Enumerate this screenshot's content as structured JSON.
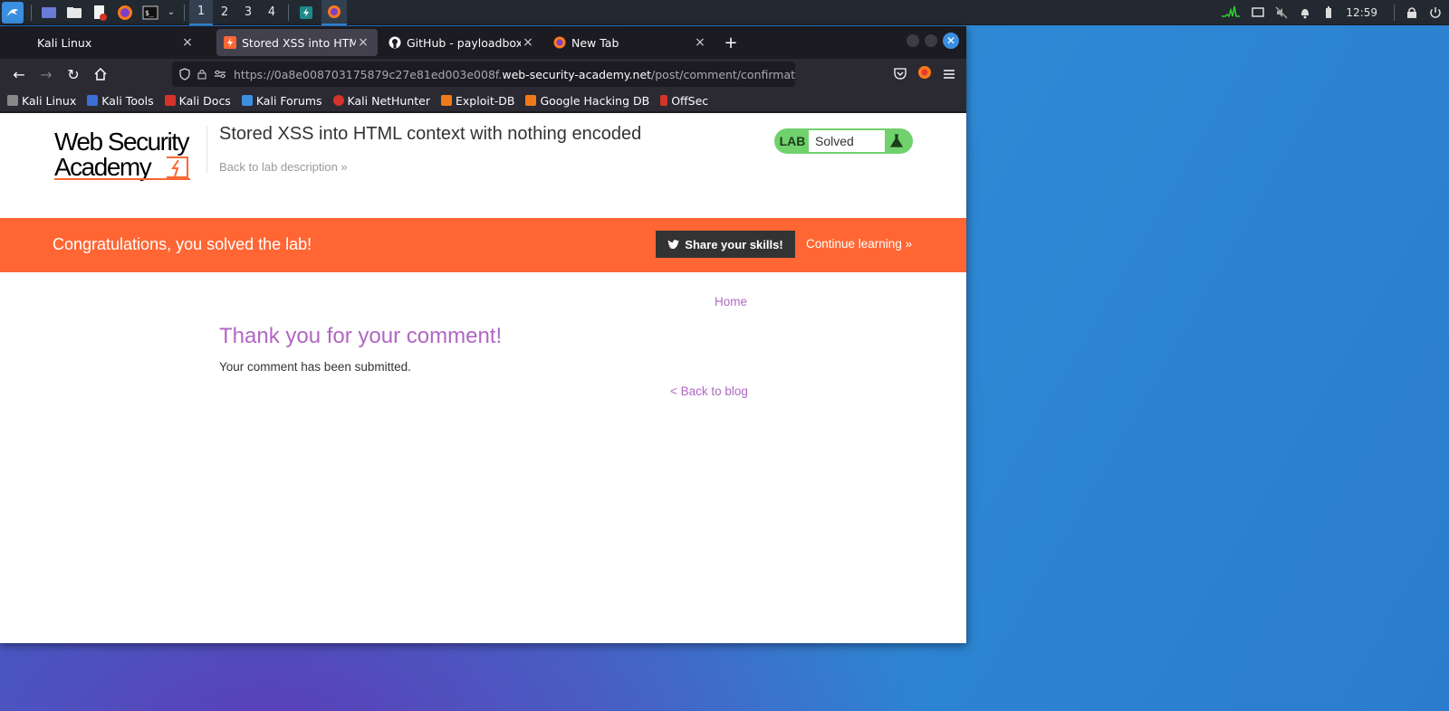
{
  "taskbar": {
    "workspaces": [
      "1",
      "2",
      "3",
      "4"
    ],
    "clock": "12:59"
  },
  "browser": {
    "tabs": [
      {
        "label": "Kali Linux"
      },
      {
        "label": "Stored XSS into HTML con"
      },
      {
        "label": "GitHub - payloadbox/xss-"
      },
      {
        "label": "New Tab"
      }
    ],
    "url": {
      "pre": "https://0a8e008703175879c27e81ed003e008f.",
      "host": "web-security-academy.net",
      "post": "/post/comment/confirmation"
    },
    "bookmarks": [
      "Kali Linux",
      "Kali Tools",
      "Kali Docs",
      "Kali Forums",
      "Kali NetHunter",
      "Exploit-DB",
      "Google Hacking DB",
      "OffSec"
    ]
  },
  "page": {
    "logo_line1": "Web Security",
    "logo_line2": "Academy",
    "lab_title": "Stored XSS into HTML context with nothing encoded",
    "back_to_description": "Back to lab description",
    "badge_label": "LAB",
    "badge_status": "Solved",
    "banner_message": "Congratulations, you solved the lab!",
    "share_label": "Share your skills!",
    "continue_label": "Continue learning",
    "home_link": "Home",
    "heading": "Thank you for your comment!",
    "submitted_text": "Your comment has been submitted.",
    "back_to_blog": "< Back to blog"
  },
  "colors": {
    "brand_orange": "#ff6633",
    "lab_green": "#70d16d",
    "link_purple": "#b167c4",
    "accent_blue": "#3b8fe0"
  }
}
